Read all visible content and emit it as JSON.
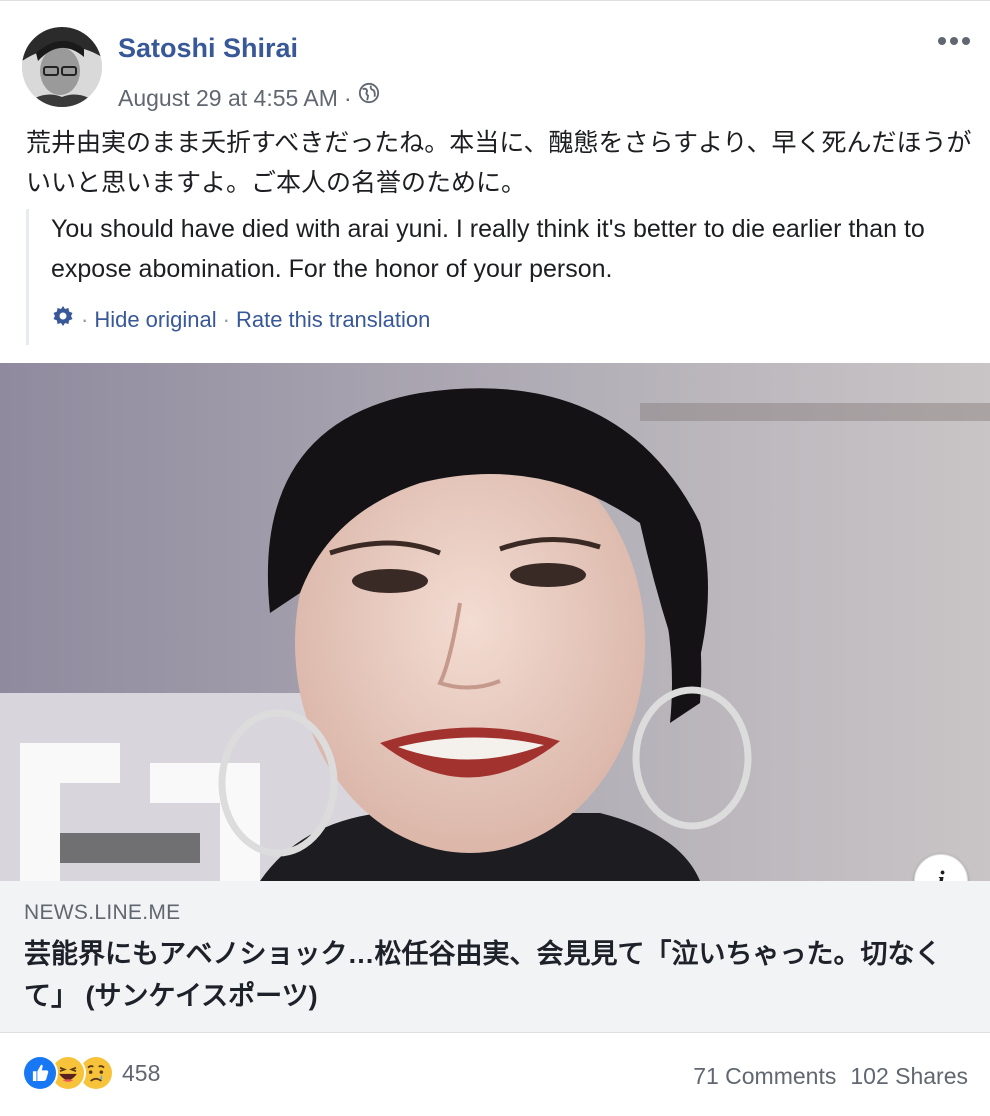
{
  "post": {
    "author": "Satoshi Shirai",
    "timestamp": "August 29 at 4:55 AM",
    "separator": "·",
    "privacy_icon": "globe-icon",
    "text": "荒井由実のまま夭折すべきだったね。本当に、醜態をさらすより、早く死んだほうがいいと思いますよ。ご本人の名誉のために。",
    "translation": {
      "text": "You should have died with arai yuni. I really think it's better to die earlier than to expose abomination. For the honor of your person.",
      "settings_icon": "gear-icon",
      "hide_original": "Hide original",
      "rate": "Rate this translation",
      "sep": "·"
    }
  },
  "link": {
    "domain": "NEWS.LINE.ME",
    "title": "芸能界にもアベノショック…松任谷由実、会見見て「泣いちゃった。切なくて」 (サンケイスポーツ)",
    "info_icon_glyph": "i"
  },
  "footer": {
    "reaction_icons": [
      "like-icon",
      "haha-icon",
      "sad-icon"
    ],
    "reaction_count": "458",
    "comments": "71 Comments",
    "shares": "102 Shares"
  },
  "colors": {
    "link_blue": "#385898",
    "secondary_text": "#606770",
    "like_blue": "#1877f2",
    "emoji_yellow": "#f7c33b"
  }
}
